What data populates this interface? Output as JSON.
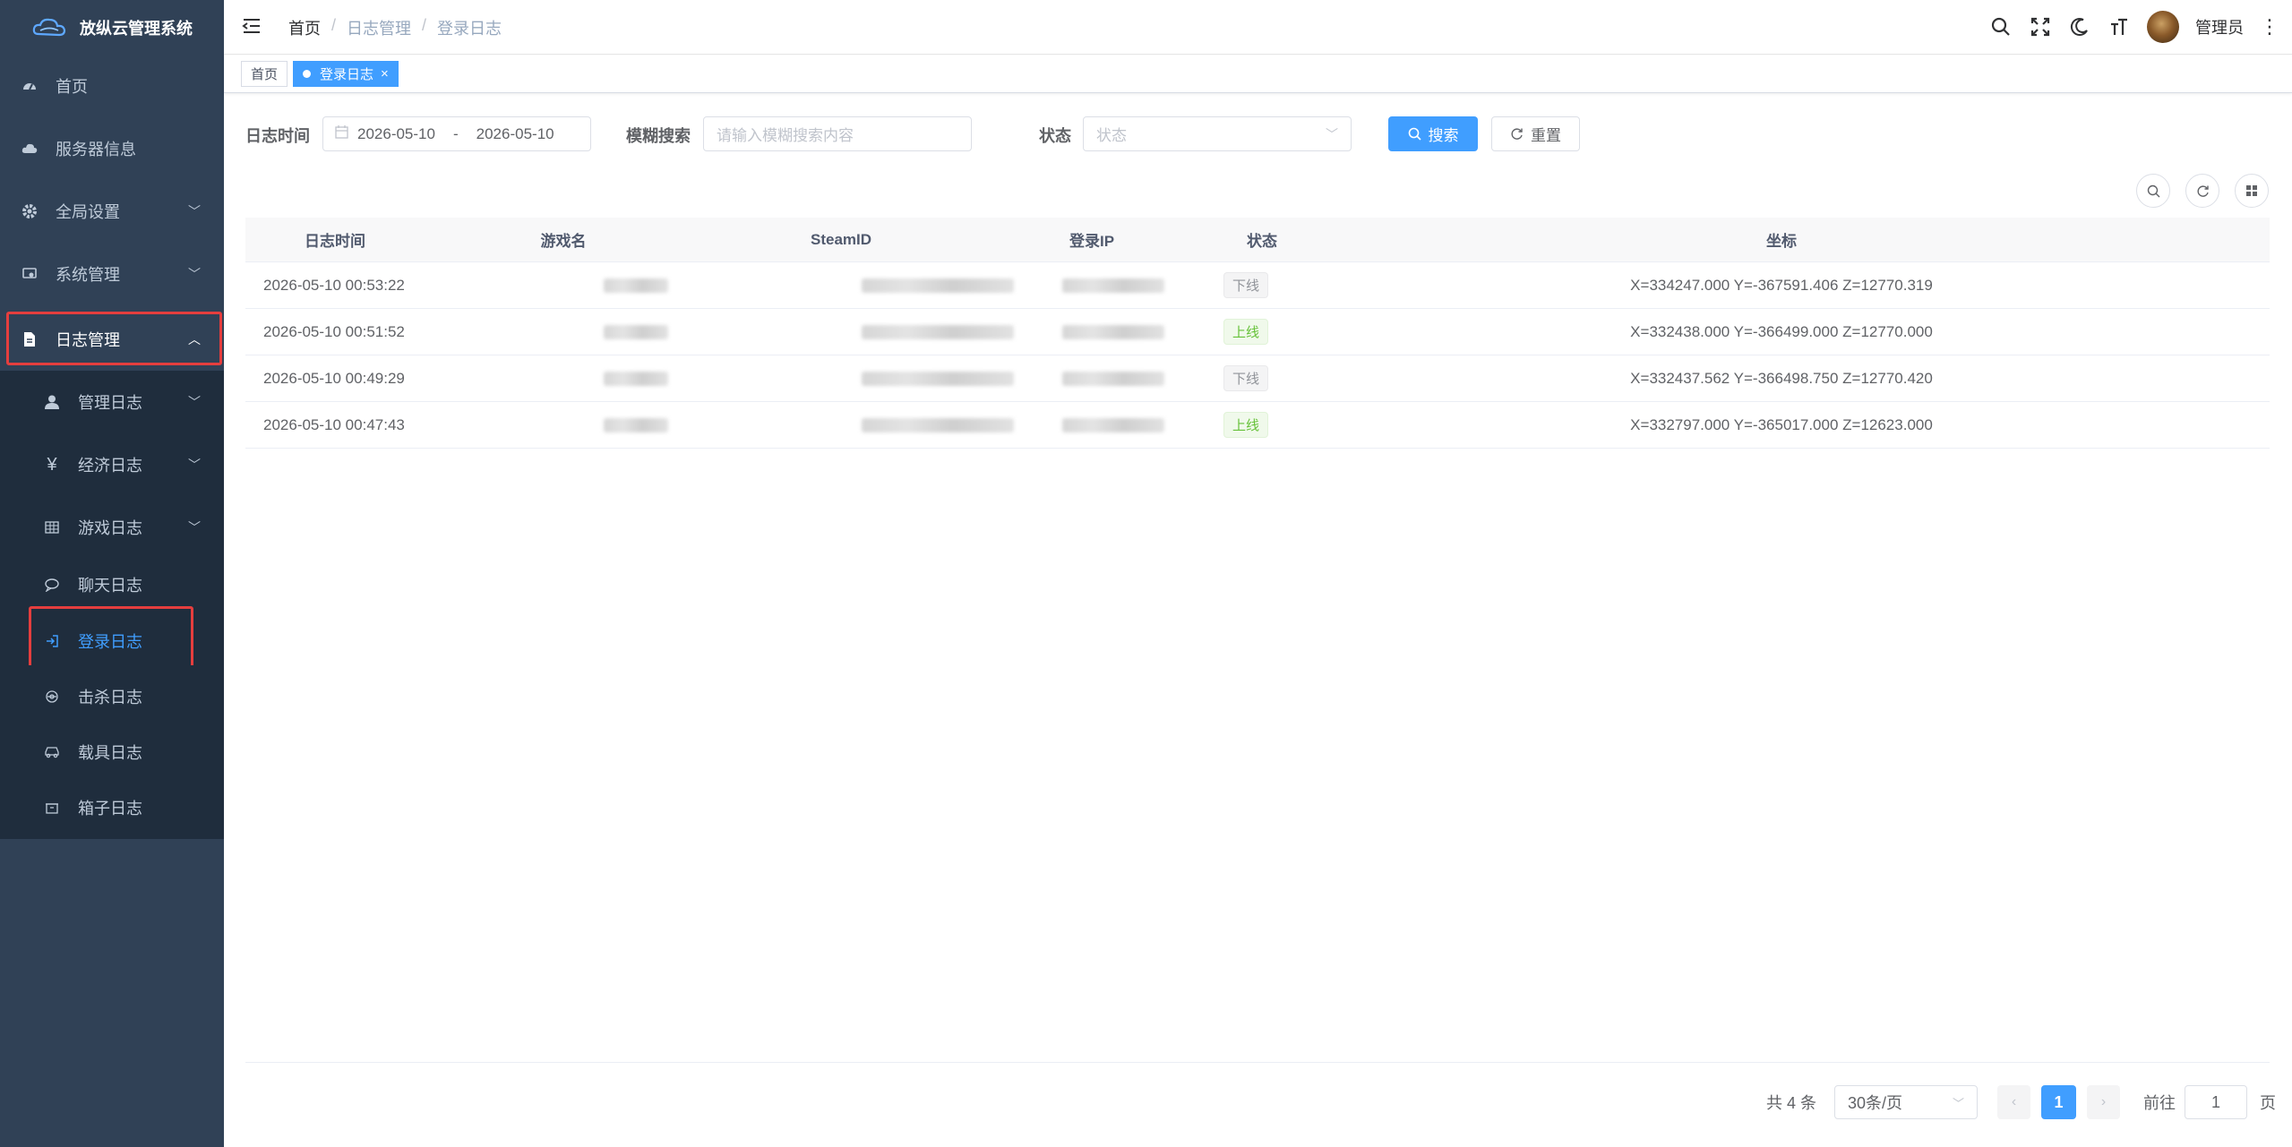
{
  "app": {
    "title": "放纵云管理系统"
  },
  "sidebar": {
    "items": [
      {
        "label": "首页",
        "icon": "dashboard-icon"
      },
      {
        "label": "服务器信息",
        "icon": "cloud-icon"
      },
      {
        "label": "全局设置",
        "icon": "gear-icon"
      },
      {
        "label": "系统管理",
        "icon": "monitor-icon"
      },
      {
        "label": "日志管理",
        "icon": "document-icon"
      }
    ],
    "log_submenu": [
      {
        "label": "管理日志",
        "icon": "user-icon"
      },
      {
        "label": "经济日志",
        "icon": "yen-icon"
      },
      {
        "label": "游戏日志",
        "icon": "grid-icon"
      },
      {
        "label": "聊天日志",
        "icon": "chat-icon"
      },
      {
        "label": "登录日志",
        "icon": "login-icon"
      },
      {
        "label": "击杀日志",
        "icon": "target-icon"
      },
      {
        "label": "载具日志",
        "icon": "car-icon"
      },
      {
        "label": "箱子日志",
        "icon": "box-icon"
      }
    ]
  },
  "header": {
    "breadcrumb": [
      "首页",
      "日志管理",
      "登录日志"
    ],
    "separator": "/",
    "user_name": "管理员"
  },
  "tags": {
    "home": "首页",
    "current": "登录日志",
    "close": "×"
  },
  "search": {
    "time_label": "日志时间",
    "date_start": "2026-05-10",
    "date_sep": "-",
    "date_end": "2026-05-10",
    "fuzzy_label": "模糊搜索",
    "fuzzy_placeholder": "请输入模糊搜索内容",
    "status_label": "状态",
    "status_placeholder": "状态",
    "search_button": "搜索",
    "reset_button": "重置"
  },
  "table": {
    "columns": [
      "日志时间",
      "游戏名",
      "SteamID",
      "登录IP",
      "状态",
      "坐标"
    ],
    "rows": [
      {
        "time": "2026-05-10 00:53:22",
        "status": "下线",
        "status_type": "off",
        "coords": "X=334247.000 Y=-367591.406 Z=12770.319"
      },
      {
        "time": "2026-05-10 00:51:52",
        "status": "上线",
        "status_type": "on",
        "coords": "X=332438.000 Y=-366499.000 Z=12770.000"
      },
      {
        "time": "2026-05-10 00:49:29",
        "status": "下线",
        "status_type": "off",
        "coords": "X=332437.562 Y=-366498.750 Z=12770.420"
      },
      {
        "time": "2026-05-10 00:47:43",
        "status": "上线",
        "status_type": "on",
        "coords": "X=332797.000 Y=-365017.000 Z=12623.000"
      }
    ]
  },
  "pagination": {
    "total_text": "共 4 条",
    "page_size": "30条/页",
    "prev": "‹",
    "current_page": "1",
    "next": "›",
    "goto_label": "前往",
    "goto_value": "1",
    "page_suffix": "页"
  },
  "colors": {
    "sidebar_bg": "#304156",
    "submenu_bg": "#1f2d3d",
    "accent": "#409eff",
    "online": "#67c23a",
    "highlight": "#e53e3e"
  }
}
